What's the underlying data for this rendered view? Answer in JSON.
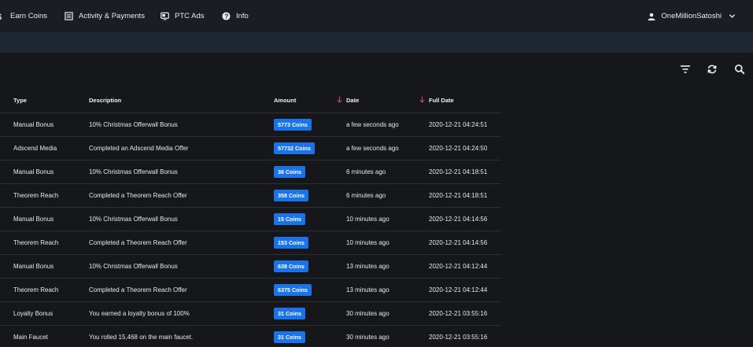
{
  "nav": {
    "earn_coins": "Earn Coins",
    "activity": "Activity & Payments",
    "ptc_ads": "PTC Ads",
    "info": "Info",
    "username": "OneMillionSatoshi"
  },
  "icons": {
    "earn": "dollar-icon",
    "activity": "list-icon",
    "ptc": "tv-icon",
    "info": "help-icon",
    "user": "person-icon",
    "filter": "filter-icon",
    "refresh": "refresh-icon",
    "search": "search-icon"
  },
  "colors": {
    "badge": "#1a73e8",
    "sort_arrow": "#d9534f"
  },
  "table": {
    "headers": {
      "type": "Type",
      "description": "Description",
      "amount": "Amount",
      "date": "Date",
      "full_date": "Full Date"
    },
    "rows": [
      {
        "type": "Manual Bonus",
        "description": "10% Christmas Offerwall Bonus",
        "amount": "5773 Coins",
        "date": "a few seconds ago",
        "full_date": "2020-12-21 04:24:51"
      },
      {
        "type": "Adscend Media",
        "description": "Completed an Adscend Media Offer",
        "amount": "57732 Coins",
        "date": "a few seconds ago",
        "full_date": "2020-12-21 04:24:50"
      },
      {
        "type": "Manual Bonus",
        "description": "10% Christmas Offerwall Bonus",
        "amount": "36 Coins",
        "date": "6 minutes ago",
        "full_date": "2020-12-21 04:18:51"
      },
      {
        "type": "Theorem Reach",
        "description": "Completed a Theorem Reach Offer",
        "amount": "358 Coins",
        "date": "6 minutes ago",
        "full_date": "2020-12-21 04:18:51"
      },
      {
        "type": "Manual Bonus",
        "description": "10% Christmas Offerwall Bonus",
        "amount": "15 Coins",
        "date": "10 minutes ago",
        "full_date": "2020-12-21 04:14:56"
      },
      {
        "type": "Theorem Reach",
        "description": "Completed a Theorem Reach Offer",
        "amount": "153 Coins",
        "date": "10 minutes ago",
        "full_date": "2020-12-21 04:14:56"
      },
      {
        "type": "Manual Bonus",
        "description": "10% Christmas Offerwall Bonus",
        "amount": "638 Coins",
        "date": "13 minutes ago",
        "full_date": "2020-12-21 04:12:44"
      },
      {
        "type": "Theorem Reach",
        "description": "Completed a Theorem Reach Offer",
        "amount": "6375 Coins",
        "date": "13 minutes ago",
        "full_date": "2020-12-21 04:12:44"
      },
      {
        "type": "Loyalty Bonus",
        "description": "You earned a loyalty bonus of 100%",
        "amount": "31 Coins",
        "date": "30 minutes ago",
        "full_date": "2020-12-21 03:55:16"
      },
      {
        "type": "Main Faucet",
        "description": "You rolled 15,468 on the main faucet.",
        "amount": "31 Coins",
        "date": "30 minutes ago",
        "full_date": "2020-12-21 03:55:16"
      }
    ]
  }
}
